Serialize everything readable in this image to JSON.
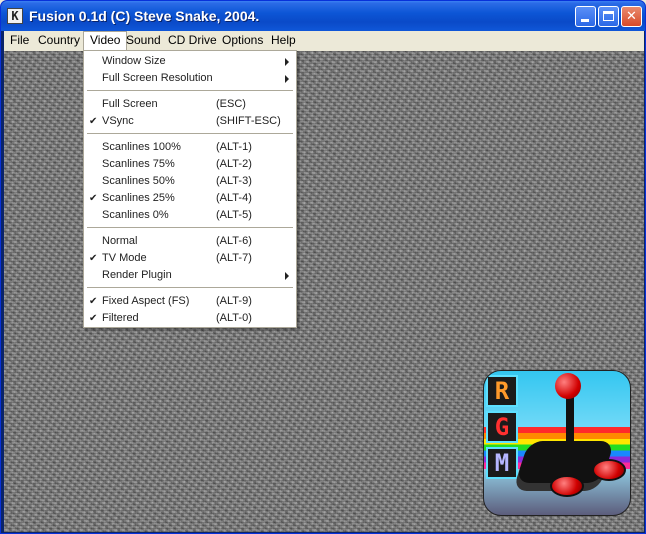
{
  "window": {
    "title": "Fusion 0.1d (C) Steve Snake, 2004.",
    "app_icon_glyph": "K",
    "controls": {
      "minimize": "minimize-icon",
      "maximize": "maximize-icon",
      "close_glyph": "✕"
    }
  },
  "menubar": {
    "items": [
      "File",
      "Country",
      "Video",
      "Sound",
      "CD Drive",
      "Options",
      "Help"
    ],
    "active": "Video"
  },
  "video_menu": {
    "items": [
      {
        "label": "Window Size",
        "accel": "",
        "checked": false,
        "submenu": true
      },
      {
        "label": "Full Screen Resolution",
        "accel": "",
        "checked": false,
        "submenu": true
      },
      {
        "label": "Full Screen",
        "accel": "(ESC)",
        "checked": false,
        "submenu": false
      },
      {
        "label": "VSync",
        "accel": "(SHIFT-ESC)",
        "checked": true,
        "submenu": false
      },
      {
        "label": "Scanlines 100%",
        "accel": "(ALT-1)",
        "checked": false,
        "submenu": false
      },
      {
        "label": "Scanlines 75%",
        "accel": "(ALT-2)",
        "checked": false,
        "submenu": false
      },
      {
        "label": "Scanlines 50%",
        "accel": "(ALT-3)",
        "checked": false,
        "submenu": false
      },
      {
        "label": "Scanlines 25%",
        "accel": "(ALT-4)",
        "checked": true,
        "submenu": false
      },
      {
        "label": "Scanlines 0%",
        "accel": "(ALT-5)",
        "checked": false,
        "submenu": false
      },
      {
        "label": "Normal",
        "accel": "(ALT-6)",
        "checked": false,
        "submenu": false
      },
      {
        "label": "TV Mode",
        "accel": "(ALT-7)",
        "checked": true,
        "submenu": false
      },
      {
        "label": "Render Plugin",
        "accel": "",
        "checked": false,
        "submenu": true
      },
      {
        "label": "Fixed Aspect (FS)",
        "accel": "(ALT-9)",
        "checked": true,
        "submenu": false
      },
      {
        "label": "Filtered",
        "accel": "(ALT-0)",
        "checked": true,
        "submenu": false
      }
    ],
    "check_glyph": "✔"
  },
  "logo": {
    "letters": [
      "R",
      "G",
      "M"
    ],
    "colors": {
      "R": "#ff9a2a",
      "G": "#ff3030",
      "M": "#b6b6ff"
    }
  }
}
